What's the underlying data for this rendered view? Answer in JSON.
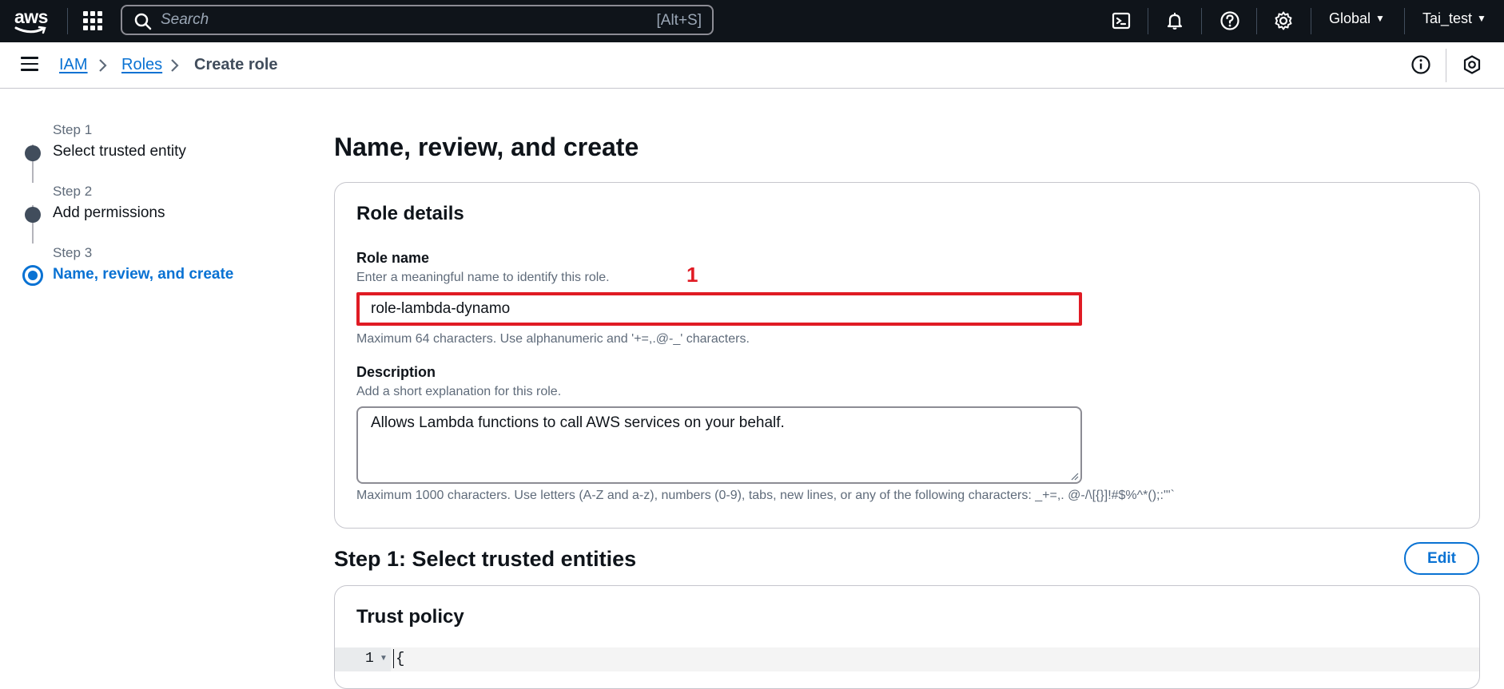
{
  "topnav": {
    "logo_text": "aws",
    "search_placeholder": "Search",
    "search_shortcut": "[Alt+S]",
    "region": "Global",
    "account": "Tai_test"
  },
  "breadcrumb": {
    "items": [
      "IAM",
      "Roles"
    ],
    "current": "Create role"
  },
  "steps": [
    {
      "number": "Step 1",
      "label": "Select trusted entity",
      "active": false
    },
    {
      "number": "Step 2",
      "label": "Add permissions",
      "active": false
    },
    {
      "number": "Step 3",
      "label": "Name, review, and create",
      "active": true
    }
  ],
  "main": {
    "title": "Name, review, and create",
    "role_details": {
      "heading": "Role details",
      "role_name_label": "Role name",
      "role_name_desc": "Enter a meaningful name to identify this role.",
      "role_name_value": "role-lambda-dynamo",
      "role_name_constraint": "Maximum 64 characters. Use alphanumeric and '+=,.@-_' characters.",
      "annotation": "1",
      "description_label": "Description",
      "description_desc": "Add a short explanation for this role.",
      "description_value": "Allows Lambda functions to call AWS services on your behalf.",
      "description_constraint": "Maximum 1000 characters. Use letters (A-Z and a-z), numbers (0-9), tabs, new lines, or any of the following characters: _+=,. @-/\\[{}]!#$%^*();:\"'`"
    },
    "step1_section": {
      "heading": "Step 1: Select trusted entities",
      "edit_label": "Edit",
      "trust_policy_heading": "Trust policy",
      "code_line_number": "1",
      "code_first_line": "{"
    }
  },
  "colors": {
    "nav_bg": "#0f141a",
    "link": "#0972d3",
    "annotation_red": "#e01b24"
  }
}
